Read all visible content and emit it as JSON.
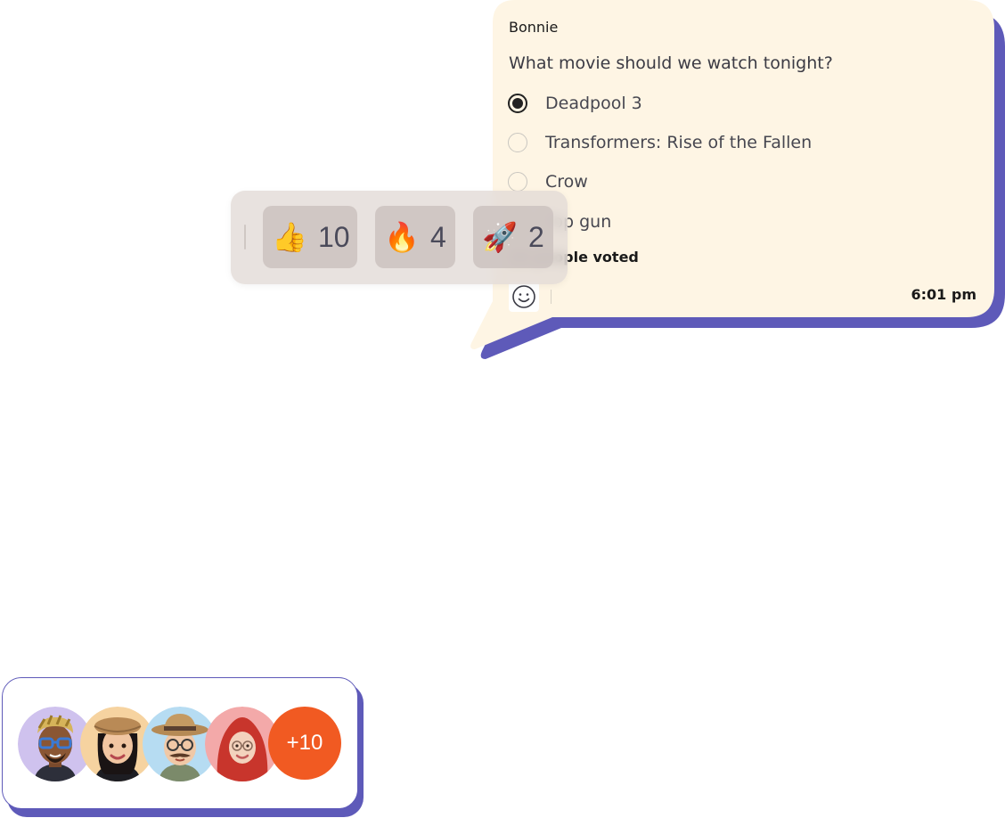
{
  "poll_message": {
    "sender": "Bonnie",
    "question": "What movie should we watch tonight?",
    "options": [
      {
        "label": "Deadpool 3",
        "selected": true
      },
      {
        "label": "Transformers: Rise of the Fallen",
        "selected": false
      },
      {
        "label": "Crow",
        "selected": false
      },
      {
        "label": "Top gun",
        "selected": false
      }
    ],
    "votes_text": "10 people voted",
    "time": "6:01 pm",
    "react_icon": "smiley-face-icon",
    "colors": {
      "bubble_fill": "#fef5e4",
      "bubble_shadow": "#5e5ab9"
    }
  },
  "reactions": [
    {
      "icon": "thumbs-up-emoji",
      "emoji": "👍",
      "count": "10"
    },
    {
      "icon": "fire-emoji",
      "emoji": "🔥",
      "count": "4"
    },
    {
      "icon": "rocket-emoji",
      "emoji": "🚀",
      "count": "2"
    }
  ],
  "participants": {
    "avatars": [
      {
        "icon": "memoji-man-blue-glasses",
        "bg": "#cfc2ee"
      },
      {
        "icon": "memoji-woman-beret",
        "bg": "#f6d3a0"
      },
      {
        "icon": "memoji-man-fedora",
        "bg": "#b6dcf2"
      },
      {
        "icon": "memoji-woman-hijab",
        "bg": "#f3a9a9"
      }
    ],
    "more_label": "+10",
    "colors": {
      "more_badge": "#f15a22",
      "card_border": "#5e5ab9"
    }
  }
}
